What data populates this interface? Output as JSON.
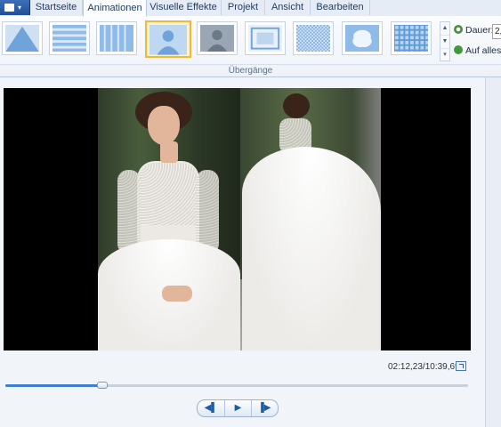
{
  "app_menu": {
    "icon": "app-menu-icon",
    "arrow": "▾"
  },
  "tabs": [
    {
      "label": "Startseite",
      "active": false
    },
    {
      "label": "Animationen",
      "active": true
    },
    {
      "label": "Visuelle Effekte",
      "active": false
    },
    {
      "label": "Projekt",
      "active": false
    },
    {
      "label": "Ansicht",
      "active": false
    },
    {
      "label": "Bearbeiten",
      "active": false
    }
  ],
  "ribbon": {
    "group_label": "Übergänge",
    "gallery": [
      {
        "icon": "transition-diagonal-icon",
        "selected": false
      },
      {
        "icon": "transition-horizontal-bars-icon",
        "selected": false
      },
      {
        "icon": "transition-vertical-bars-icon",
        "selected": false
      },
      {
        "icon": "transition-fade-icon",
        "selected": true
      },
      {
        "icon": "transition-dissolve-icon",
        "selected": false
      },
      {
        "icon": "transition-zoom-icon",
        "selected": false
      },
      {
        "icon": "transition-checker-icon",
        "selected": false
      },
      {
        "icon": "transition-shape-icon",
        "selected": false
      },
      {
        "icon": "transition-mosaic-icon",
        "selected": false
      }
    ],
    "scroll": {
      "up": "▲",
      "down": "▼",
      "more": "▾"
    },
    "duration_label": "Dauer:",
    "duration_value": "2,",
    "apply_all_label": "Auf alles a"
  },
  "player": {
    "timecode": "02:12,23/10:39,69",
    "progress": 0.21,
    "buttons": {
      "prev": "◀▌",
      "play": "▶",
      "next": "▐▶"
    }
  },
  "colors": {
    "accent": "#3c7fd1",
    "selected_border": "#f0b83a",
    "tab_text": "#1e3a5f"
  }
}
